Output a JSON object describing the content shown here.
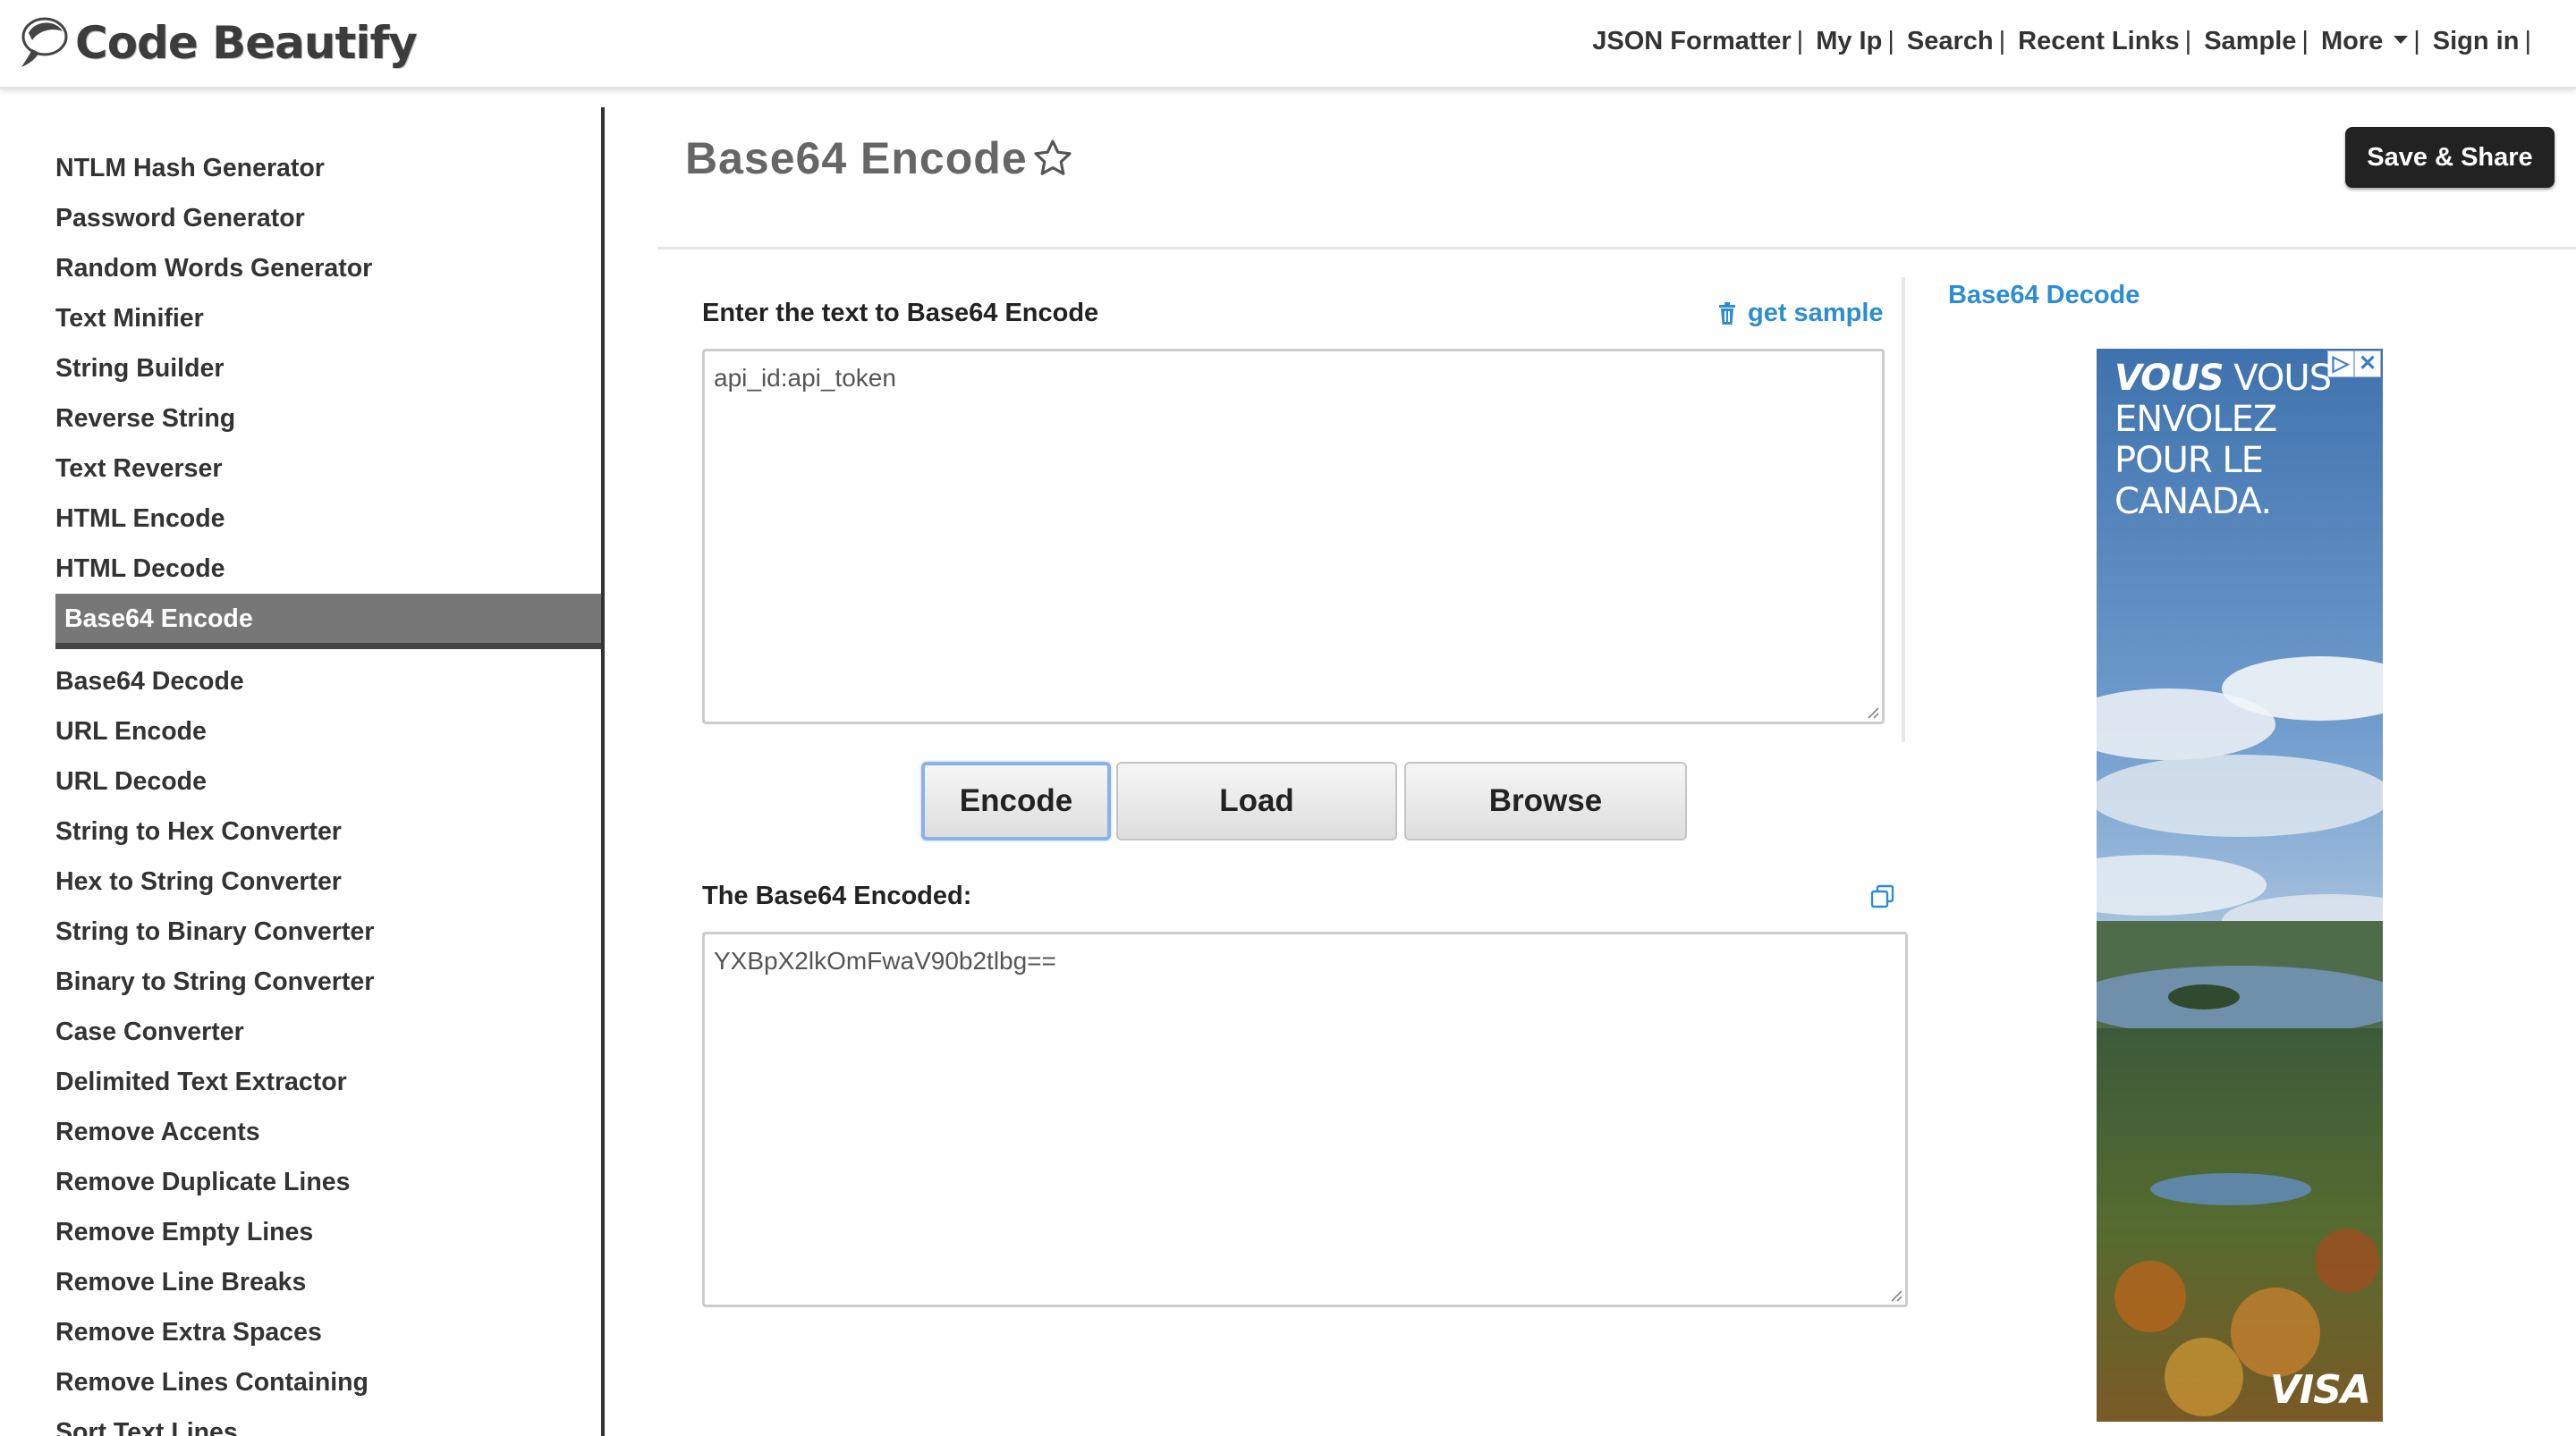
{
  "header": {
    "logo_text": "Code Beautify",
    "nav": [
      {
        "label": "JSON Formatter",
        "sep": "|"
      },
      {
        "label": "My Ip",
        "sep": "|"
      },
      {
        "label": "Search",
        "sep": "|"
      },
      {
        "label": "Recent Links",
        "sep": "|"
      },
      {
        "label": "Sample",
        "sep": "|"
      },
      {
        "label": "More",
        "sep": "|"
      },
      {
        "label": "Sign in",
        "sep": "|"
      }
    ]
  },
  "sidebar": {
    "items": [
      "NTLM Hash Generator",
      "Password Generator",
      "Random Words Generator",
      "Text Minifier",
      "String Builder",
      "Reverse String",
      "Text Reverser",
      "HTML Encode",
      "HTML Decode",
      "Base64 Encode",
      "Base64 Decode",
      "URL Encode",
      "URL Decode",
      "String to Hex Converter",
      "Hex to String Converter",
      "String to Binary Converter",
      "Binary to String Converter",
      "Case Converter",
      "Delimited Text Extractor",
      "Remove Accents",
      "Remove Duplicate Lines",
      "Remove Empty Lines",
      "Remove Line Breaks",
      "Remove Extra Spaces",
      "Remove Lines Containing",
      "Sort Text Lines"
    ],
    "active": "Base64 Encode"
  },
  "main": {
    "title": "Base64 Encode",
    "save_share": "Save & Share",
    "input_label": "Enter the text to Base64 Encode",
    "get_sample": "get sample",
    "input_value": "api_id:api_token",
    "buttons": {
      "encode": "Encode",
      "load": "Load",
      "browse": "Browse"
    },
    "output_label": "The Base64 Encoded:",
    "output_value": "YXBpX2lkOmFwaV90b2tlbg=="
  },
  "right": {
    "decode_link": "Base64 Decode",
    "ad": {
      "headline_em": "VOUS",
      "headline_rest": "VOUS ENVOLEZ POUR LE CANADA.",
      "brand": "VISA"
    }
  },
  "colors": {
    "link": "#2d8dd0",
    "active_bg": "#777777",
    "button_dark": "#222222"
  }
}
